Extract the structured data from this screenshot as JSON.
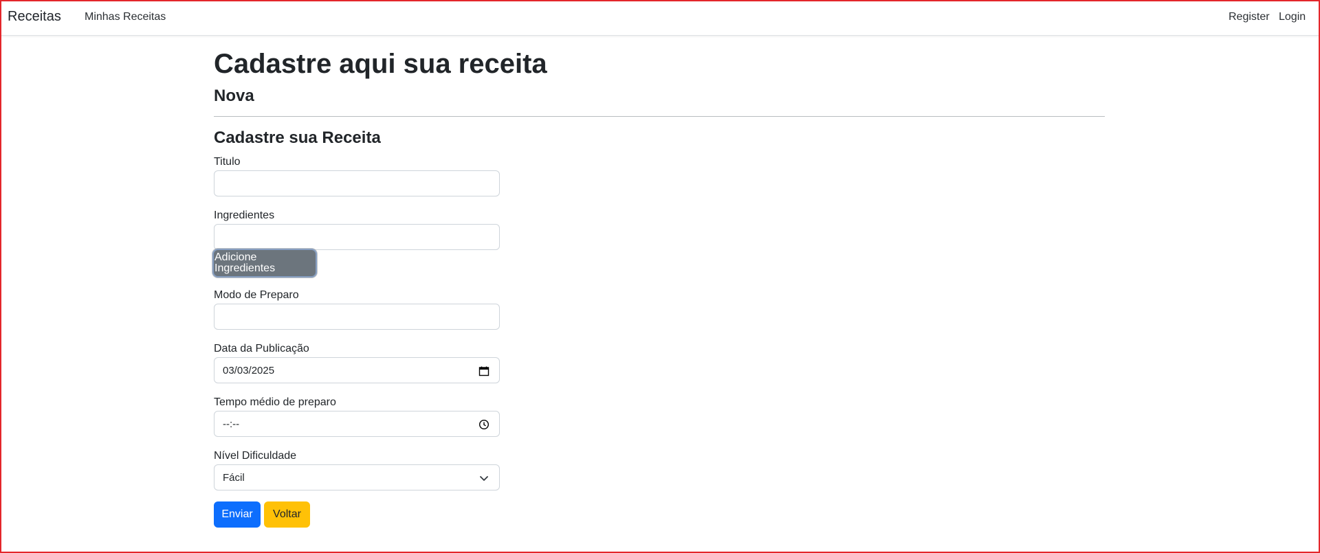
{
  "nav": {
    "brand": "Receitas",
    "links": {
      "minhas": "Minhas Receitas",
      "register": "Register",
      "login": "Login"
    }
  },
  "page": {
    "title": "Cadastre aqui sua receita",
    "subtitle": "Nova",
    "form_title": "Cadastre sua Receita"
  },
  "form": {
    "titulo": {
      "label": "Titulo",
      "value": ""
    },
    "ingredientes": {
      "label": "Ingredientes",
      "value": "",
      "add_button": "Adicione Ingredientes"
    },
    "modo_preparo": {
      "label": "Modo de Preparo",
      "value": ""
    },
    "data_publicacao": {
      "label": "Data da Publicação",
      "value": "03/03/2025",
      "icon": "calendar-icon"
    },
    "tempo_medio": {
      "label": "Tempo médio de preparo",
      "value": "--:--",
      "icon": "clock-icon"
    },
    "nivel_dificuldade": {
      "label": "Nível Dificuldade",
      "selected": "Fácil",
      "icon": "chevron-down-icon"
    },
    "buttons": {
      "submit": "Enviar",
      "back": "Voltar"
    }
  },
  "colors": {
    "primary": "#0d6efd",
    "secondary": "#6c757d",
    "warning": "#ffc107",
    "frame_border": "#e3262b"
  }
}
